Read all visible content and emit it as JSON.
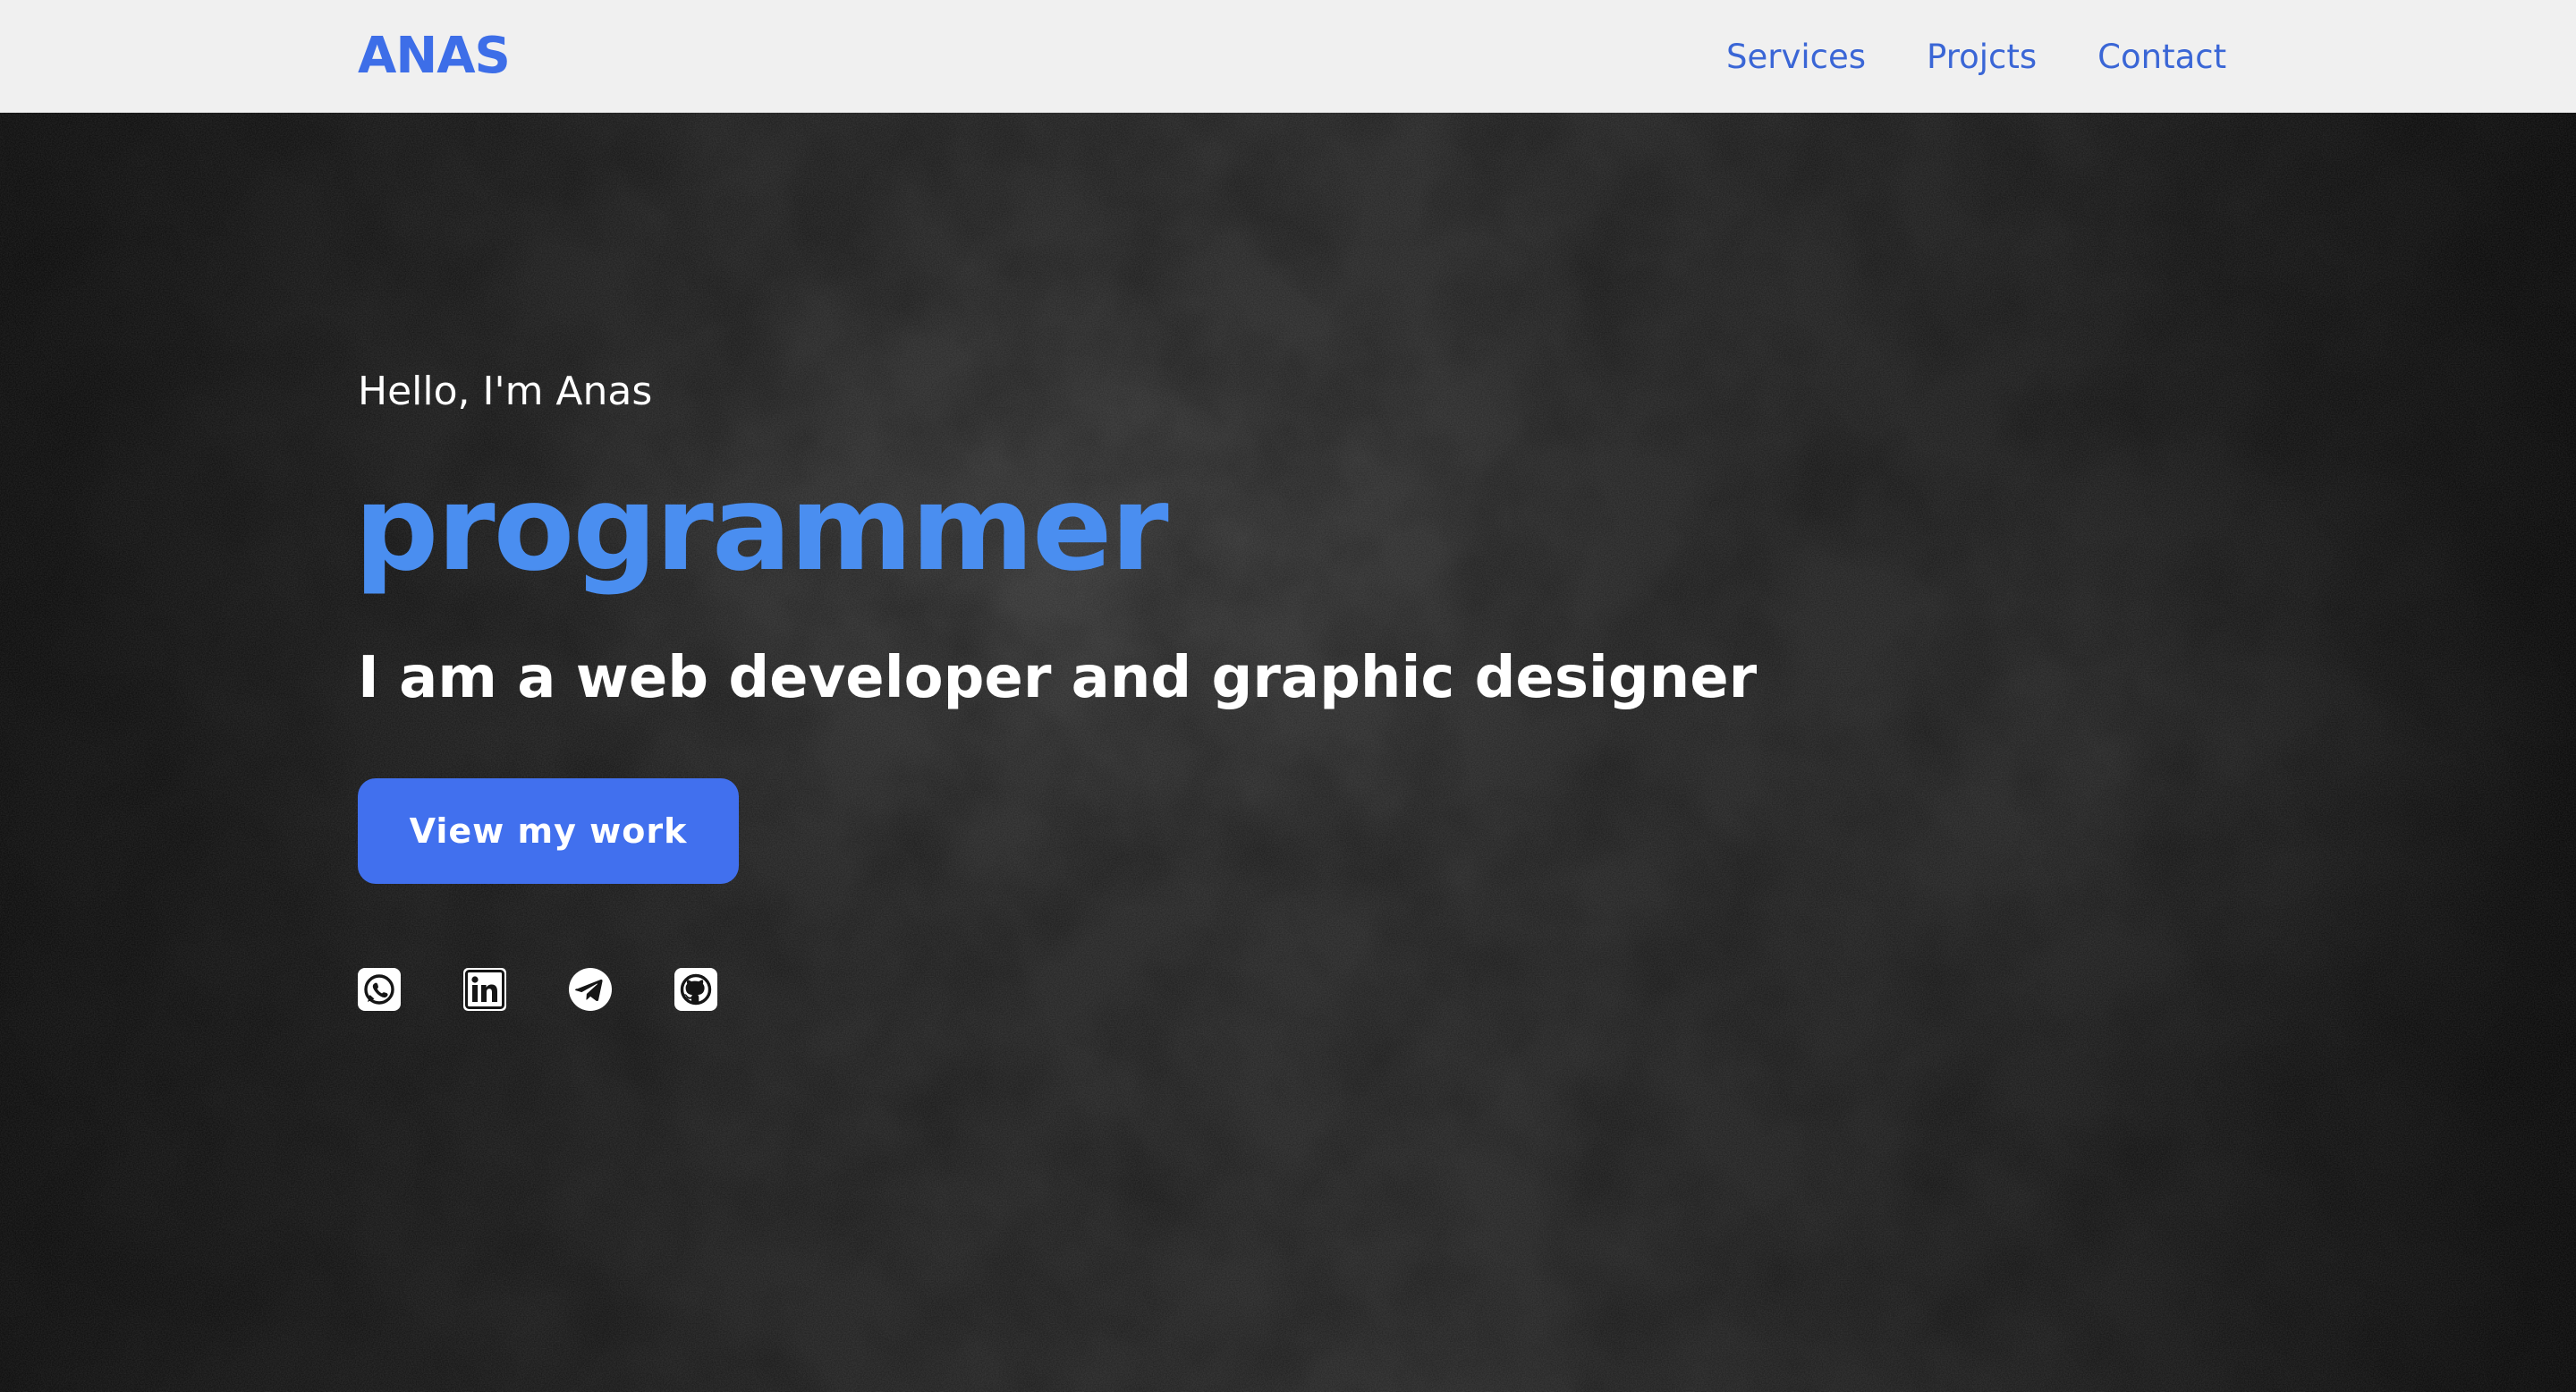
{
  "header": {
    "brand": "ANAS",
    "nav": [
      {
        "label": "Services"
      },
      {
        "label": "Projcts"
      },
      {
        "label": "Contact"
      }
    ]
  },
  "hero": {
    "greeting": "Hello, I'm Anas",
    "role": "programmer",
    "tagline": "I am a web developer and graphic designer",
    "cta_label": "View my work"
  },
  "social": [
    {
      "icon": "whatsapp-icon"
    },
    {
      "icon": "linkedin-icon"
    },
    {
      "icon": "telegram-icon"
    },
    {
      "icon": "github-icon"
    }
  ],
  "colors": {
    "brand": "#3d6ee8",
    "nav_link": "#3a66d6",
    "role": "#4a8ef0",
    "button": "#4170ee",
    "header_bg": "#f0f0f0",
    "hero_bg": "#1c1c1c"
  }
}
